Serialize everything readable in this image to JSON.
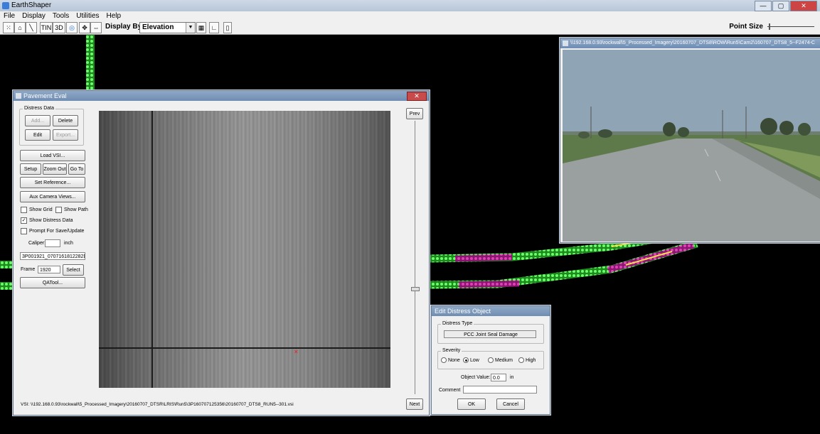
{
  "app": {
    "title": "EarthShaper",
    "window_buttons": [
      "—",
      "▢",
      "✕"
    ]
  },
  "menu": [
    "File",
    "Display",
    "Tools",
    "Utilities",
    "Help"
  ],
  "toolbar": {
    "btn_tin": "TIN",
    "btn_3d": "3D",
    "display_by_label": "Display By",
    "display_by_value": "Elevation",
    "point_size_label": "Point Size"
  },
  "pavement": {
    "title": "Pavement Eval",
    "close": "✕",
    "distress_group": "Distress Data",
    "add": "Add...",
    "delete": "Delete",
    "edit": "Edit",
    "export": "Export...",
    "load_vsi": "Load VSI...",
    "setup": "Setup",
    "zoom_out": "Zoom Out",
    "go_to": "Go To",
    "set_reference": "Set Reference...",
    "aux_camera": "Aux Camera Views...",
    "show_grid": "Show Grid",
    "show_path": "Show Path",
    "show_distress": "Show Distress Data",
    "prompt_save": "Prompt For Save/Update",
    "caliper_label": "Caliper:",
    "caliper_unit": "inch",
    "file_id": "3P001921_0707161812282D",
    "frame_label": "Frame",
    "frame_value": "1920",
    "select": "Select",
    "qa_tool": "QATool...",
    "prev": "Prev",
    "next": "Next",
    "vsi_path": "VSI: \\\\192.168.0.93\\rockwall\\5_Processed_Imagery\\20160707_DTSR\\LRIS\\Run5\\3P160707125356\\20160707_DTS8_RUN5--301.vsi"
  },
  "camera": {
    "title": "\\\\192.168.0.93\\rockwall\\5_Processed_Imagery\\20160707_DTS8\\ROW\\Run5\\Cam2\\160707_DTS8_5--F2474-C"
  },
  "edit_distress": {
    "title": "Edit Distress Object",
    "type_group": "Distress Type",
    "type_value": "PCC Joint Seal Damage",
    "severity_group": "Severity",
    "sev_none": "None",
    "sev_low": "Low",
    "sev_medium": "Medium",
    "sev_high": "High",
    "object_value_label": "Object Value:",
    "object_value": "0.0",
    "object_value_unit": "in",
    "comment_label": "Comment",
    "ok": "OK",
    "cancel": "Cancel"
  },
  "colors": {
    "track_green": "#3fd23f",
    "track_magenta": "#c0208f",
    "track_yellow": "#f4e04a"
  }
}
